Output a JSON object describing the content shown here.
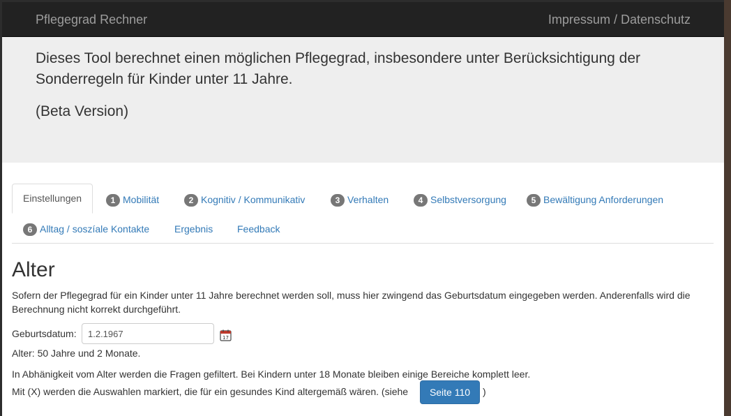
{
  "navbar": {
    "brand": "Pflegegrad Rechner",
    "right_link": "Impressum / Datenschutz"
  },
  "jumbotron": {
    "lead": "Dieses Tool berechnet einen möglichen Pflegegrad, insbesondere unter Berücksichtigung der Sonderregeln für Kinder unter 11 Jahre.",
    "beta": "(Beta Version)"
  },
  "tabs": [
    {
      "badge": "",
      "label": "Einstellungen",
      "active": true
    },
    {
      "badge": "1",
      "label": "Mobilität"
    },
    {
      "badge": "2",
      "label": "Kognitiv / Kommunikativ"
    },
    {
      "badge": "3",
      "label": "Verhalten"
    },
    {
      "badge": "4",
      "label": "Selbstversorgung"
    },
    {
      "badge": "5",
      "label": "Bewältigung Anforderungen"
    },
    {
      "badge": "6",
      "label": "Alltag / soszíale Kontakte"
    },
    {
      "badge": "",
      "label": "Ergebnis"
    },
    {
      "badge": "",
      "label": "Feedback"
    }
  ],
  "section": {
    "title": "Alter",
    "description": "Sofern der Pflegegrad für ein Kinder unter 11 Jahre berechnet werden soll, muss hier zwingend das Geburtsdatum eingegeben werden. Anderenfalls wird die Berechnung nicht korrekt durchgeführt.",
    "dob_label": "Geburtsdatum:",
    "dob_value": "1.2.1967",
    "age_text": "Alter: 50 Jahre und 2 Monate.",
    "filter_text": "In Abhänigkeit vom Alter werden die Fragen gefiltert. Bei Kindern unter 18 Monate bleiben einige Bereiche komplett leer.",
    "hint_text": "Mit (X) werden die Auswahlen markiert, die für ein gesundes Kind altergemäß wären. (siehe",
    "page_button": "Seite 110",
    "hint_close": ")"
  },
  "icons": {
    "calendar": "calendar-icon",
    "calendar_day": "17"
  },
  "colors": {
    "navbar_bg": "#222222",
    "jumbotron_bg": "#eeeeee",
    "link": "#337ab7",
    "badge": "#777777",
    "button": "#337ab7"
  }
}
